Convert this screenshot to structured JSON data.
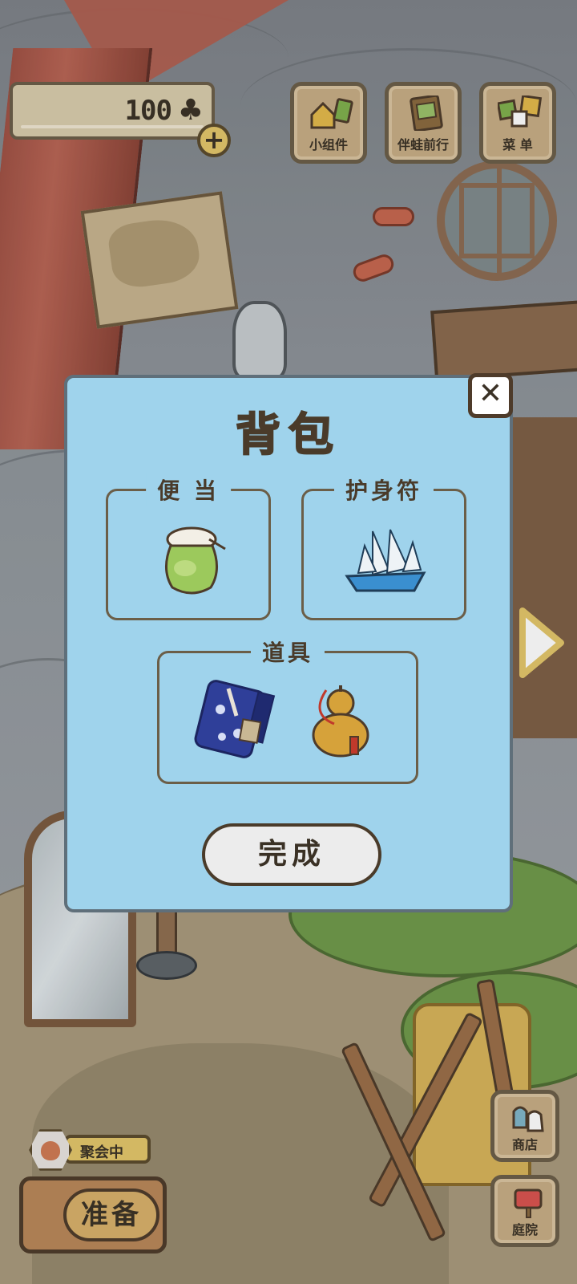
{
  "hud": {
    "clover_count": "100",
    "clover_icon": "♣",
    "plus_label": "+"
  },
  "top_buttons": {
    "widgets_label": "小组件",
    "travel_label": "伴蛙前行",
    "menu_label": "菜 单"
  },
  "side_buttons": {
    "shop_label": "商店",
    "garden_label": "庭院"
  },
  "status": {
    "party_label": "聚会中"
  },
  "prepare_button": {
    "label": "准备"
  },
  "backpack": {
    "title": "背包",
    "close_label": "✕",
    "sections": {
      "lunch": {
        "label": "便 当",
        "items": [
          "green-jar-lunch"
        ]
      },
      "charm": {
        "label": "护身符",
        "items": [
          "paper-ship-charm"
        ]
      },
      "tools": {
        "label": "道具",
        "items": [
          "blue-tent-roll",
          "gourd-lantern"
        ]
      }
    },
    "done_label": "完成"
  },
  "colors": {
    "modal_bg": "#9fd3ec",
    "button_wood": "#c7ad85",
    "text_brown": "#3a3125",
    "accent_yellow": "#e3c66a"
  }
}
